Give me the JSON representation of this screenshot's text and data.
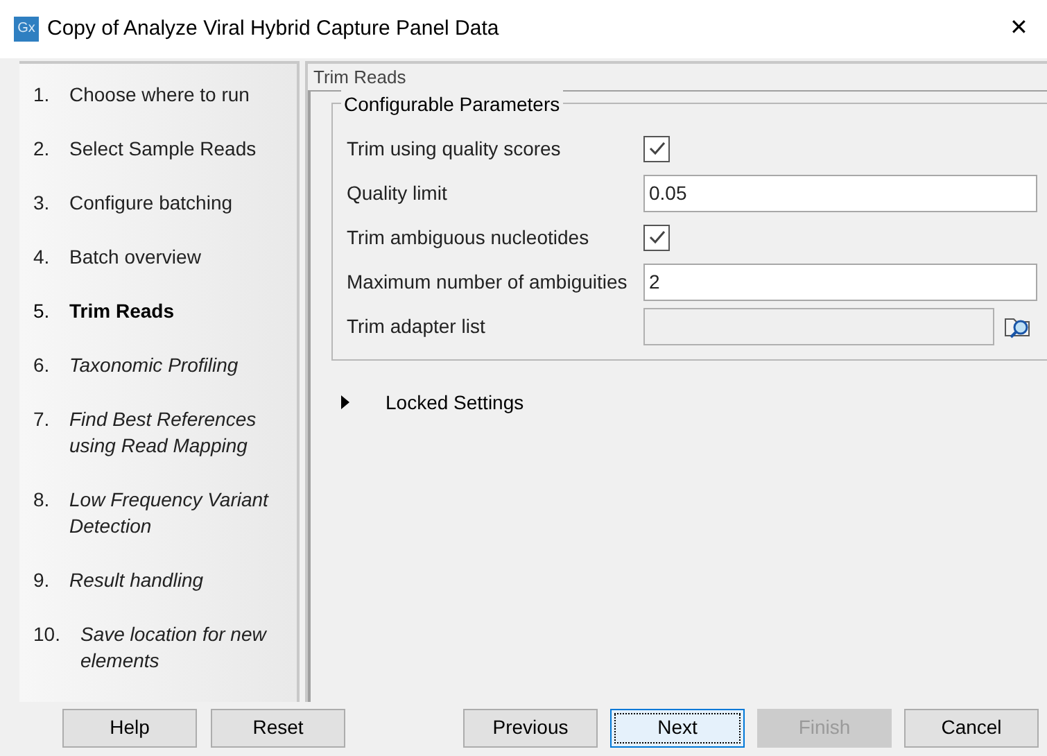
{
  "window": {
    "logo": "Gx",
    "title": "Copy of Analyze Viral Hybrid Capture Panel Data",
    "close": "✕"
  },
  "steps": [
    {
      "number": "1.",
      "label": "Choose where to run",
      "selected": false,
      "completed": true
    },
    {
      "number": "2.",
      "label": "Select Sample Reads",
      "selected": false,
      "completed": true
    },
    {
      "number": "3.",
      "label": "Configure batching",
      "selected": false,
      "completed": true
    },
    {
      "number": "4.",
      "label": "Batch overview",
      "selected": false,
      "completed": true
    },
    {
      "number": "5.",
      "label": "Trim Reads",
      "selected": true,
      "completed": true
    },
    {
      "number": "6.",
      "label": "Taxonomic Profiling",
      "selected": false,
      "completed": false
    },
    {
      "number": "7.",
      "label": "Find Best References using Read Mapping",
      "selected": false,
      "completed": false
    },
    {
      "number": "8.",
      "label": "Low Frequency Variant Detection",
      "selected": false,
      "completed": false
    },
    {
      "number": "9.",
      "label": "Result handling",
      "selected": false,
      "completed": false
    },
    {
      "number": "10.",
      "label": "Save location for new elements",
      "selected": false,
      "completed": false
    }
  ],
  "panel": {
    "title": "Trim Reads",
    "group_title": "Configurable Parameters",
    "parameters": [
      {
        "kind": "checkbox",
        "label": "Trim using quality scores",
        "checked": true
      },
      {
        "kind": "text",
        "label": "Quality limit",
        "value": "0.05"
      },
      {
        "kind": "checkbox",
        "label": "Trim ambiguous nucleotides",
        "checked": true
      },
      {
        "kind": "text",
        "label": "Maximum number of ambiguities",
        "value": "2"
      },
      {
        "kind": "file",
        "label": "Trim adapter list",
        "disabled": true
      }
    ],
    "locked_settings": {
      "label": "Locked Settings",
      "expanded": false
    }
  },
  "buttons": [
    {
      "label": "Help",
      "disabled": false,
      "focused": false
    },
    {
      "label": "Reset",
      "disabled": false,
      "focused": false
    },
    {
      "label": "Previous",
      "disabled": false,
      "focused": false
    },
    {
      "label": "Next",
      "disabled": false,
      "focused": true
    },
    {
      "label": "Finish",
      "disabled": true,
      "focused": false
    },
    {
      "label": "Cancel",
      "disabled": false,
      "focused": false
    }
  ]
}
